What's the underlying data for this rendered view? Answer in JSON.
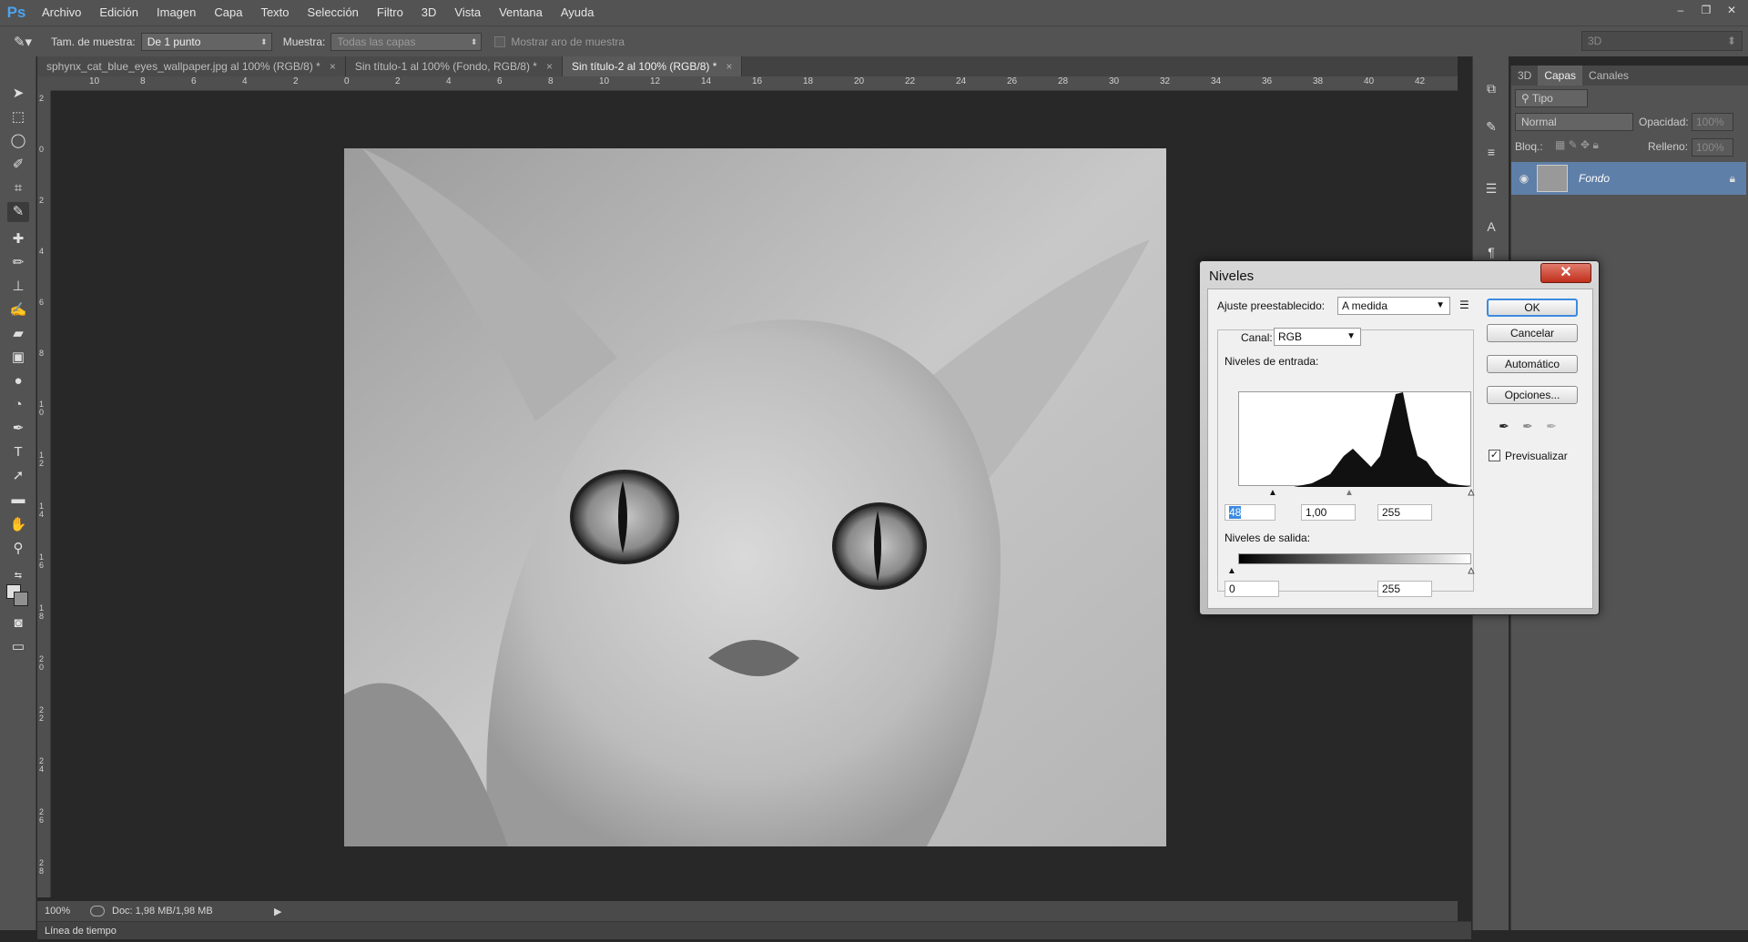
{
  "app": {
    "logo": "Ps"
  },
  "menu": [
    "Archivo",
    "Edición",
    "Imagen",
    "Capa",
    "Texto",
    "Selección",
    "Filtro",
    "3D",
    "Vista",
    "Ventana",
    "Ayuda"
  ],
  "window_controls": [
    "–",
    "❐",
    "✕"
  ],
  "options_bar": {
    "sample_size_label": "Tam. de muestra:",
    "sample_size_value": "De 1 punto",
    "sample_label": "Muestra:",
    "sample_value": "Todas las capas",
    "show_ring_label": "Mostrar aro de muestra",
    "workspace_value": "3D"
  },
  "tabs": [
    {
      "label": "sphynx_cat_blue_eyes_wallpaper.jpg al 100% (RGB/8) *",
      "close": "×"
    },
    {
      "label": "Sin título-1 al 100% (Fondo, RGB/8) *",
      "close": "×"
    },
    {
      "label": "Sin título-2 al 100% (RGB/8) *",
      "close": "×"
    }
  ],
  "ruler_top": [
    "10",
    "8",
    "6",
    "4",
    "2",
    "0",
    "2",
    "4",
    "6",
    "8",
    "10",
    "12",
    "14",
    "16",
    "18",
    "20",
    "22",
    "24",
    "26",
    "28",
    "30",
    "32",
    "34",
    "36",
    "38",
    "40",
    "42"
  ],
  "ruler_left": [
    "2",
    "0",
    "2",
    "4",
    "6",
    "8",
    "10",
    "12",
    "14",
    "16",
    "18",
    "20",
    "22",
    "24",
    "26",
    "28"
  ],
  "status": {
    "zoom": "100%",
    "doc": "Doc: 1,98 MB/1,98 MB"
  },
  "timeline_label": "Línea de tiempo",
  "layers_panel": {
    "tabs": [
      "3D",
      "Capas",
      "Canales"
    ],
    "filter_value": "Tipo",
    "blend_mode": "Normal",
    "opacity_label": "Opacidad:",
    "opacity_value": "100%",
    "lock_label": "Bloq.:",
    "fill_label": "Relleno:",
    "fill_value": "100%",
    "layer_name": "Fondo"
  },
  "levels_dialog": {
    "title": "Niveles",
    "close": "✕",
    "preset_label": "Ajuste preestablecido:",
    "preset_value": "A medida",
    "channel_label": "Canal:",
    "channel_value": "RGB",
    "input_label": "Niveles de entrada:",
    "input_black": "48",
    "input_gamma": "1,00",
    "input_white": "255",
    "output_label": "Niveles de salida:",
    "output_black": "0",
    "output_white": "255",
    "ok": "OK",
    "cancel": "Cancelar",
    "auto": "Automático",
    "options": "Opciones...",
    "preview_label": "Previsualizar",
    "preview_checked": true
  }
}
